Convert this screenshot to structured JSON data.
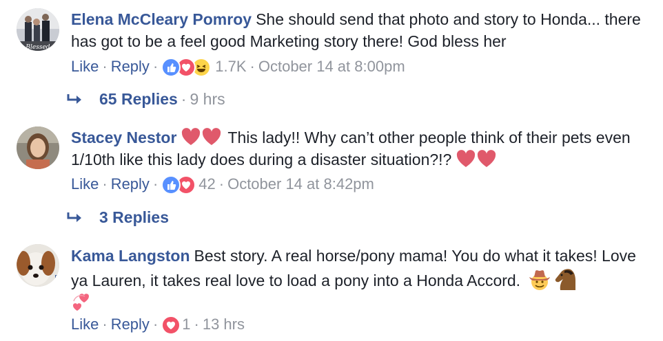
{
  "comments": [
    {
      "name": "Elena McCleary Pomroy",
      "text": "She should send that photo and story to Honda... there has got to be a feel good Marketing story there! God bless her",
      "like": "Like",
      "reply": "Reply",
      "reaction_count": "1.7K",
      "time": "October 14 at 8:00pm",
      "replies_label": "65 Replies",
      "replies_time": "9 hrs"
    },
    {
      "name": "Stacey Nestor",
      "text_main": "This lady!! Why can’t other people think of their pets even 1/10th like this lady does during a disaster situation?!?",
      "like": "Like",
      "reply": "Reply",
      "reaction_count": "42",
      "time": "October 14 at 8:42pm",
      "replies_label": "3 Replies"
    },
    {
      "name": "Kama Langston",
      "text": "Best story. A real horse/pony mama! You do what it takes! Love ya Lauren, it takes real love to load a pony into a Honda Accord.",
      "like": "Like",
      "reply": "Reply",
      "reaction_count": "1",
      "time": "13 hrs"
    }
  ],
  "separators": {
    "dot": "·"
  },
  "icons": {
    "reply_arrow": "reply-arrow-icon",
    "like": "like-reaction-icon",
    "love": "love-reaction-icon",
    "haha": "haha-reaction-icon",
    "heart": "heart-emoji",
    "cowboy": "cowboy-emoji",
    "horse": "horse-emoji",
    "hearts": "revolving-hearts-emoji"
  },
  "colors": {
    "link": "#385898",
    "meta": "#90949c",
    "text": "#1d2129",
    "like_blue": "#5890ff",
    "love_red": "#f25268"
  }
}
